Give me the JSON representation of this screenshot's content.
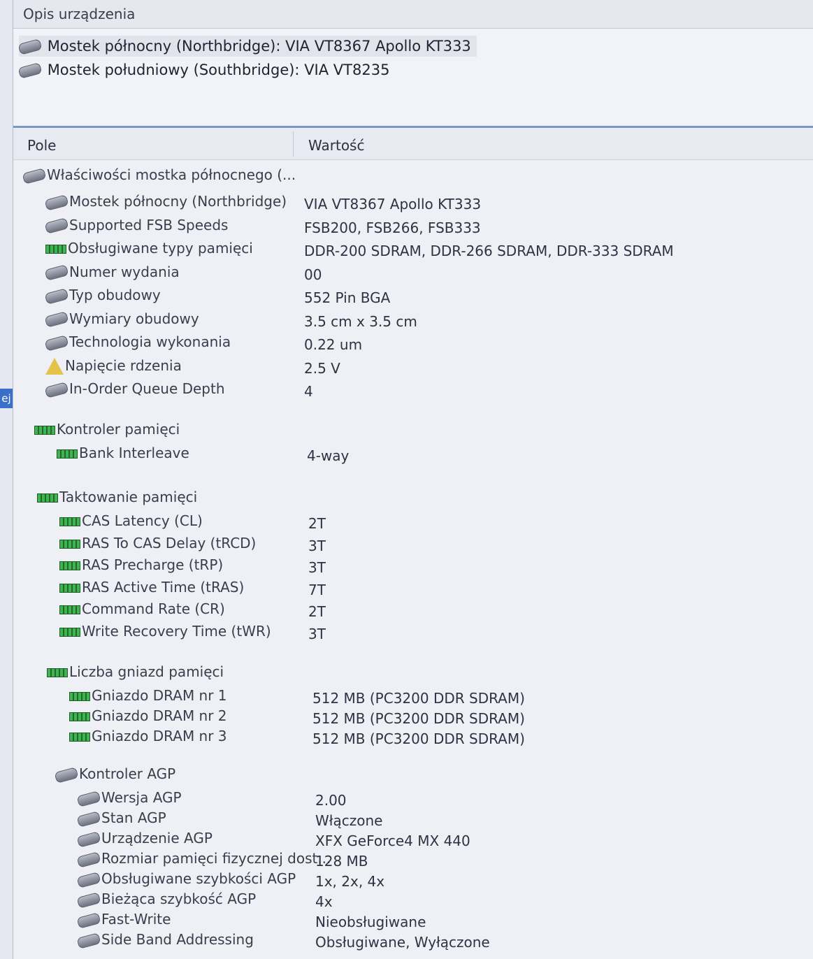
{
  "header": {
    "title": "Opis urządzenia"
  },
  "devices": [
    "Mostek północny (Northbridge): VIA VT8367 Apollo KT333",
    "Mostek południowy (Southbridge): VIA VT8235"
  ],
  "left_tab": "ej",
  "columns": {
    "field": "Pole",
    "value": "Wartość"
  },
  "groups": [
    {
      "name": "Właściwości mostka północnego (...",
      "icon": "chip-icon",
      "items": [
        {
          "name": "Mostek północny (Northbridge)",
          "value": "VIA VT8367 Apollo KT333",
          "icon": "chip-icon"
        },
        {
          "name": "Supported FSB Speeds",
          "value": "FSB200, FSB266, FSB333",
          "icon": "chip-icon"
        },
        {
          "name": "Obsługiwane typy pamięci",
          "value": "DDR-200 SDRAM, DDR-266 SDRAM, DDR-333 SDRAM",
          "icon": "memory-icon"
        },
        {
          "name": "Numer wydania",
          "value": "00",
          "icon": "chip-icon"
        },
        {
          "name": "Typ obudowy",
          "value": "552 Pin BGA",
          "icon": "chip-icon"
        },
        {
          "name": "Wymiary obudowy",
          "value": "3.5 cm x 3.5 cm",
          "icon": "chip-icon"
        },
        {
          "name": "Technologia wykonania",
          "value": "0.22 um",
          "icon": "chip-icon"
        },
        {
          "name": "Napięcie rdzenia",
          "value": "2.5 V",
          "icon": "warning-icon"
        },
        {
          "name": "In-Order Queue Depth",
          "value": "4",
          "icon": "chip-icon"
        }
      ]
    },
    {
      "name": "Kontroler pamięci",
      "icon": "memory-icon",
      "items": [
        {
          "name": "Bank Interleave",
          "value": "4-way",
          "icon": "memory-icon"
        }
      ]
    },
    {
      "name": "Taktowanie pamięci",
      "icon": "memory-icon",
      "items": [
        {
          "name": "CAS Latency (CL)",
          "value": "2T",
          "icon": "memory-icon"
        },
        {
          "name": "RAS To CAS Delay (tRCD)",
          "value": "3T",
          "icon": "memory-icon"
        },
        {
          "name": "RAS Precharge (tRP)",
          "value": "3T",
          "icon": "memory-icon"
        },
        {
          "name": "RAS Active Time (tRAS)",
          "value": "7T",
          "icon": "memory-icon"
        },
        {
          "name": "Command Rate (CR)",
          "value": "2T",
          "icon": "memory-icon"
        },
        {
          "name": "Write Recovery Time (tWR)",
          "value": "3T",
          "icon": "memory-icon"
        }
      ]
    },
    {
      "name": "Liczba gniazd pamięci",
      "icon": "memory-icon",
      "items": [
        {
          "name": "Gniazdo DRAM nr 1",
          "value": "512 MB  (PC3200 DDR SDRAM)",
          "icon": "memory-icon"
        },
        {
          "name": "Gniazdo DRAM nr 2",
          "value": "512 MB  (PC3200 DDR SDRAM)",
          "icon": "memory-icon"
        },
        {
          "name": "Gniazdo DRAM nr 3",
          "value": "512 MB  (PC3200 DDR SDRAM)",
          "icon": "memory-icon"
        }
      ]
    },
    {
      "name": "Kontroler AGP",
      "icon": "chip-icon",
      "items": [
        {
          "name": "Wersja AGP",
          "value": "2.00",
          "icon": "chip-icon"
        },
        {
          "name": "Stan AGP",
          "value": "Włączone",
          "icon": "chip-icon"
        },
        {
          "name": "Urządzenie AGP",
          "value": "XFX GeForce4 MX 440",
          "icon": "chip-icon"
        },
        {
          "name": "Rozmiar pamięci fizycznej dost...",
          "value": "128 MB",
          "icon": "chip-icon"
        },
        {
          "name": "Obsługiwane szybkości AGP",
          "value": "1x, 2x, 4x",
          "icon": "chip-icon"
        },
        {
          "name": "Bieżąca szybkość AGP",
          "value": "4x",
          "icon": "chip-icon"
        },
        {
          "name": "Fast-Write",
          "value": "Nieobsługiwane",
          "icon": "chip-icon"
        },
        {
          "name": "Side Band Addressing",
          "value": "Obsługiwane, Wyłączone",
          "icon": "chip-icon"
        }
      ]
    }
  ]
}
